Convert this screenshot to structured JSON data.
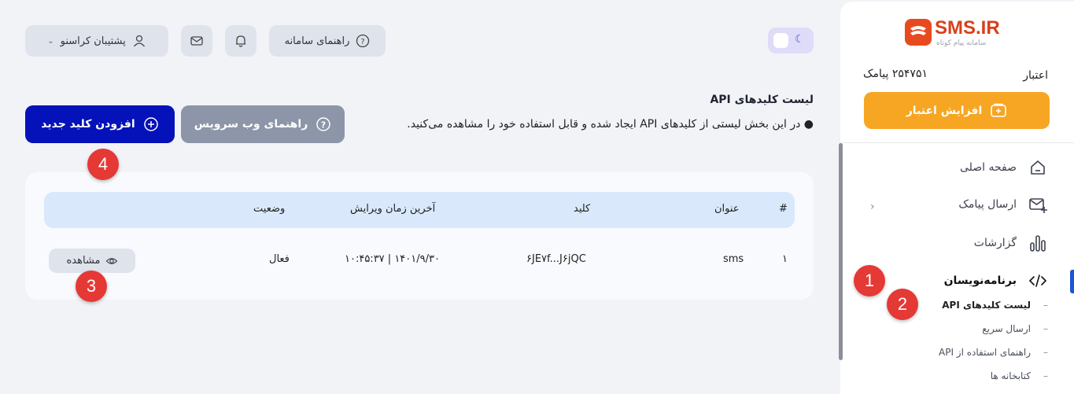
{
  "brand": {
    "logo_text": "SMS.IR",
    "logo_sub": "سامانه پیام کوتاه"
  },
  "header": {
    "support_label": "پشتیبان کراسنو",
    "help_label": "راهنمای سامانه",
    "theme_toggle": "dark-mode-toggle"
  },
  "sidebar": {
    "credit_label": "اعتبار",
    "credit_value": "۲۵۴۷۵۱ پیامک",
    "increase_credit_label": "افزایش اعتبار",
    "items": [
      {
        "label": "صفحه اصلی",
        "icon": "home-icon"
      },
      {
        "label": "ارسال پیامک",
        "icon": "mail-plus-icon"
      },
      {
        "label": "گزارشات",
        "icon": "chart-icon"
      },
      {
        "label": "برنامه‌نویسان",
        "icon": "code-icon"
      }
    ],
    "sub_items": [
      {
        "label": "لیست کلیدهای API"
      },
      {
        "label": "ارسال سریع"
      },
      {
        "label": "راهنمای استفاده از API"
      },
      {
        "label": "کتابخانه ها"
      }
    ]
  },
  "main": {
    "title": "لیست کلیدهای API",
    "description": "در این بخش لیستی از کلیدهای API ایجاد شده و قابل استفاده خود را مشاهده می‌کنید.",
    "web_service_guide_label": "راهنمای وب سرویس",
    "add_key_label": "افزودن کلید جدید"
  },
  "table": {
    "columns": [
      "#",
      "عنوان",
      "کلید",
      "آخرین زمان ویرایش",
      "وضعیت"
    ],
    "rows": [
      {
        "index": "۱",
        "title": "sms",
        "key": "۶JE۷f...J۶jQC",
        "last_edit": "۱۴۰۱/۹/۳۰ | ۱۰:۴۵:۳۷",
        "status": "فعال",
        "action": "مشاهده"
      }
    ]
  },
  "annotations": [
    "1",
    "2",
    "3",
    "4"
  ],
  "colors": {
    "primary": "#0511b9",
    "accent": "#f6a623",
    "badge": "#e53935"
  }
}
